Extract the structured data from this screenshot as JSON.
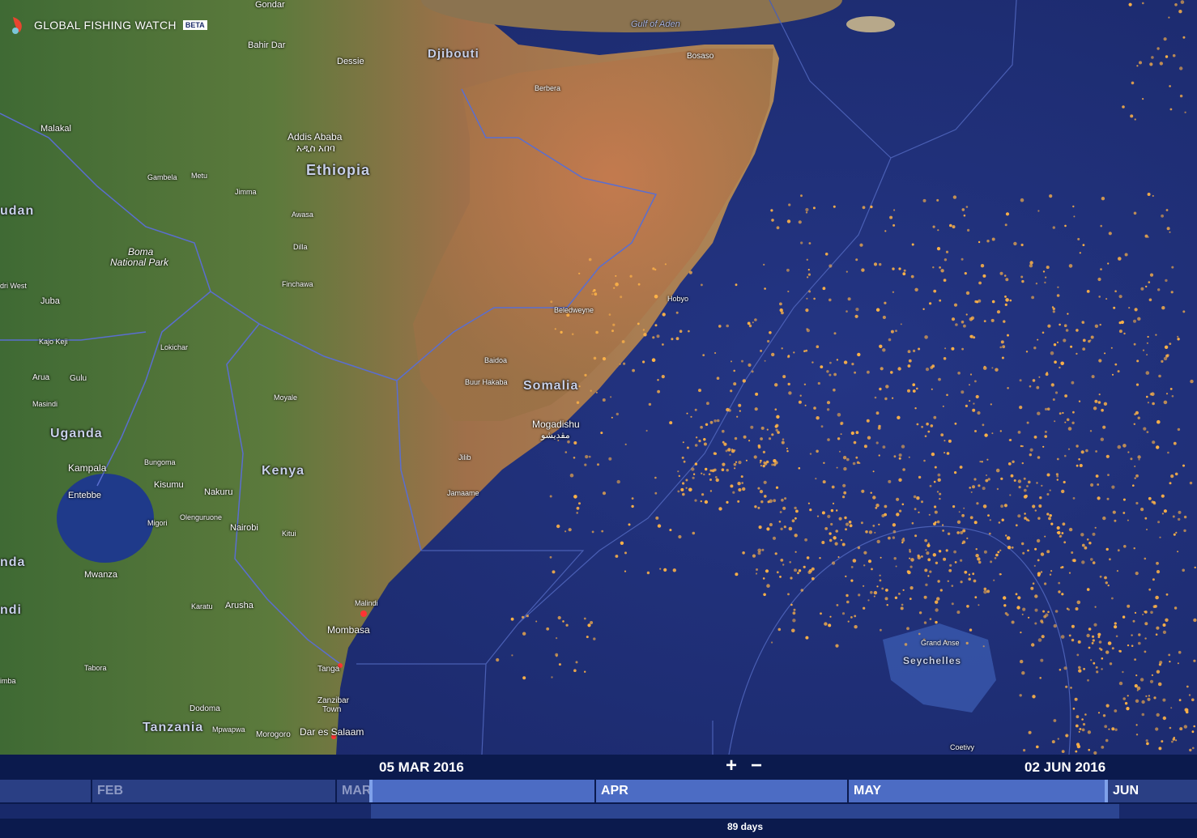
{
  "brand": {
    "name": "GLOBAL FISHING WATCH",
    "badge": "BETA"
  },
  "map": {
    "countries": [
      {
        "id": "ethiopia",
        "text": "Ethiopia"
      },
      {
        "id": "somalia",
        "text": "Somalia"
      },
      {
        "id": "kenya",
        "text": "Kenya"
      },
      {
        "id": "uganda",
        "text": "Uganda"
      },
      {
        "id": "tanzania",
        "text": "Tanzania"
      },
      {
        "id": "djibouti",
        "text": "Djibouti"
      },
      {
        "id": "sudan",
        "text": "udan"
      },
      {
        "id": "rwanda",
        "text": "nda"
      },
      {
        "id": "burundi",
        "text": "ndi"
      },
      {
        "id": "seychelles",
        "text": "Seychelles"
      }
    ],
    "places": [
      {
        "id": "gondar",
        "text": "Gondar"
      },
      {
        "id": "bahir-dar",
        "text": "Bahir Dar"
      },
      {
        "id": "dessie",
        "text": "Dessie"
      },
      {
        "id": "malakal",
        "text": "Malakal"
      },
      {
        "id": "addis-ababa",
        "text": "Addis Ababa"
      },
      {
        "id": "addis-ababa-amharic",
        "text": "አዲስ አበባ"
      },
      {
        "id": "gambela",
        "text": "Gambela"
      },
      {
        "id": "metu",
        "text": "Metu"
      },
      {
        "id": "jimma",
        "text": "Jimma"
      },
      {
        "id": "awasa",
        "text": "Awasa"
      },
      {
        "id": "dilla",
        "text": "Dilla"
      },
      {
        "id": "boma",
        "text": "Boma"
      },
      {
        "id": "boma-np",
        "text": "National Park"
      },
      {
        "id": "juba",
        "text": "Juba"
      },
      {
        "id": "kajo-keji",
        "text": "Kajo Keji"
      },
      {
        "id": "arua",
        "text": "Arua"
      },
      {
        "id": "gulu",
        "text": "Gulu"
      },
      {
        "id": "masindi",
        "text": "Masindi"
      },
      {
        "id": "kampala",
        "text": "Kampala"
      },
      {
        "id": "entebbe",
        "text": "Entebbe"
      },
      {
        "id": "bungoma",
        "text": "Bungoma"
      },
      {
        "id": "kisumu",
        "text": "Kisumu"
      },
      {
        "id": "nakuru",
        "text": "Nakuru"
      },
      {
        "id": "migori",
        "text": "Migori"
      },
      {
        "id": "nairobi",
        "text": "Nairobi"
      },
      {
        "id": "kitui",
        "text": "Kitui"
      },
      {
        "id": "mwanza",
        "text": "Mwanza"
      },
      {
        "id": "arusha",
        "text": "Arusha"
      },
      {
        "id": "malindi",
        "text": "Malindi"
      },
      {
        "id": "mombasa",
        "text": "Mombasa"
      },
      {
        "id": "tanga",
        "text": "Tanga"
      },
      {
        "id": "tabora",
        "text": "Tabora"
      },
      {
        "id": "zanzibar",
        "text": "Zanzibar"
      },
      {
        "id": "zanzibar-town",
        "text": "Town"
      },
      {
        "id": "dodoma",
        "text": "Dodoma"
      },
      {
        "id": "morogoro",
        "text": "Morogoro"
      },
      {
        "id": "dar-es-salaam",
        "text": "Dar es Salaam"
      },
      {
        "id": "mogadishu",
        "text": "Mogadishu"
      },
      {
        "id": "mogadishu-ar",
        "text": "مقديشو"
      },
      {
        "id": "baidoa",
        "text": "Baidoa"
      },
      {
        "id": "buur-hakaba",
        "text": "Buur Hakaba"
      },
      {
        "id": "jilib",
        "text": "Jilib"
      },
      {
        "id": "jamaame",
        "text": "Jamaame"
      },
      {
        "id": "berbera",
        "text": "Berbera"
      },
      {
        "id": "bosaso",
        "text": "Bosaso"
      },
      {
        "id": "hobyo",
        "text": "Hobyo"
      },
      {
        "id": "beledweyne",
        "text": "Beledweyne"
      },
      {
        "id": "gulf-of-aden",
        "text": "Gulf of Aden"
      },
      {
        "id": "grand-anse",
        "text": "Grand Anse"
      },
      {
        "id": "coetivy",
        "text": "Coetivy"
      },
      {
        "id": "olenguruone",
        "text": "Olenguruone"
      },
      {
        "id": "pinchawa",
        "text": "Finchawa"
      },
      {
        "id": "moyale",
        "text": "Moyale"
      },
      {
        "id": "west",
        "text": "dri West"
      },
      {
        "id": "dimba",
        "text": "imba"
      },
      {
        "id": "mpwapwa",
        "text": "Mpwapwa"
      },
      {
        "id": "lokichar",
        "text": "Lokichar"
      },
      {
        "id": "karatu",
        "text": "Karatu"
      }
    ],
    "colors": {
      "ocean": "#1f2f78",
      "land": "#8a6a3e",
      "boundary": "#6f84d8",
      "fishing": "#ffb347"
    }
  },
  "timebar": {
    "start_date": "05 MAR 2016",
    "end_date": "02 JUN 2016",
    "zoom_in": "+",
    "zoom_out": "−",
    "months": [
      {
        "id": "jan",
        "label": ""
      },
      {
        "id": "feb",
        "label": "FEB"
      },
      {
        "id": "mar",
        "label": "MAR"
      },
      {
        "id": "apr",
        "label": "APR"
      },
      {
        "id": "may",
        "label": "MAY"
      },
      {
        "id": "jun",
        "label": "JUN"
      }
    ],
    "duration": "89 days"
  }
}
